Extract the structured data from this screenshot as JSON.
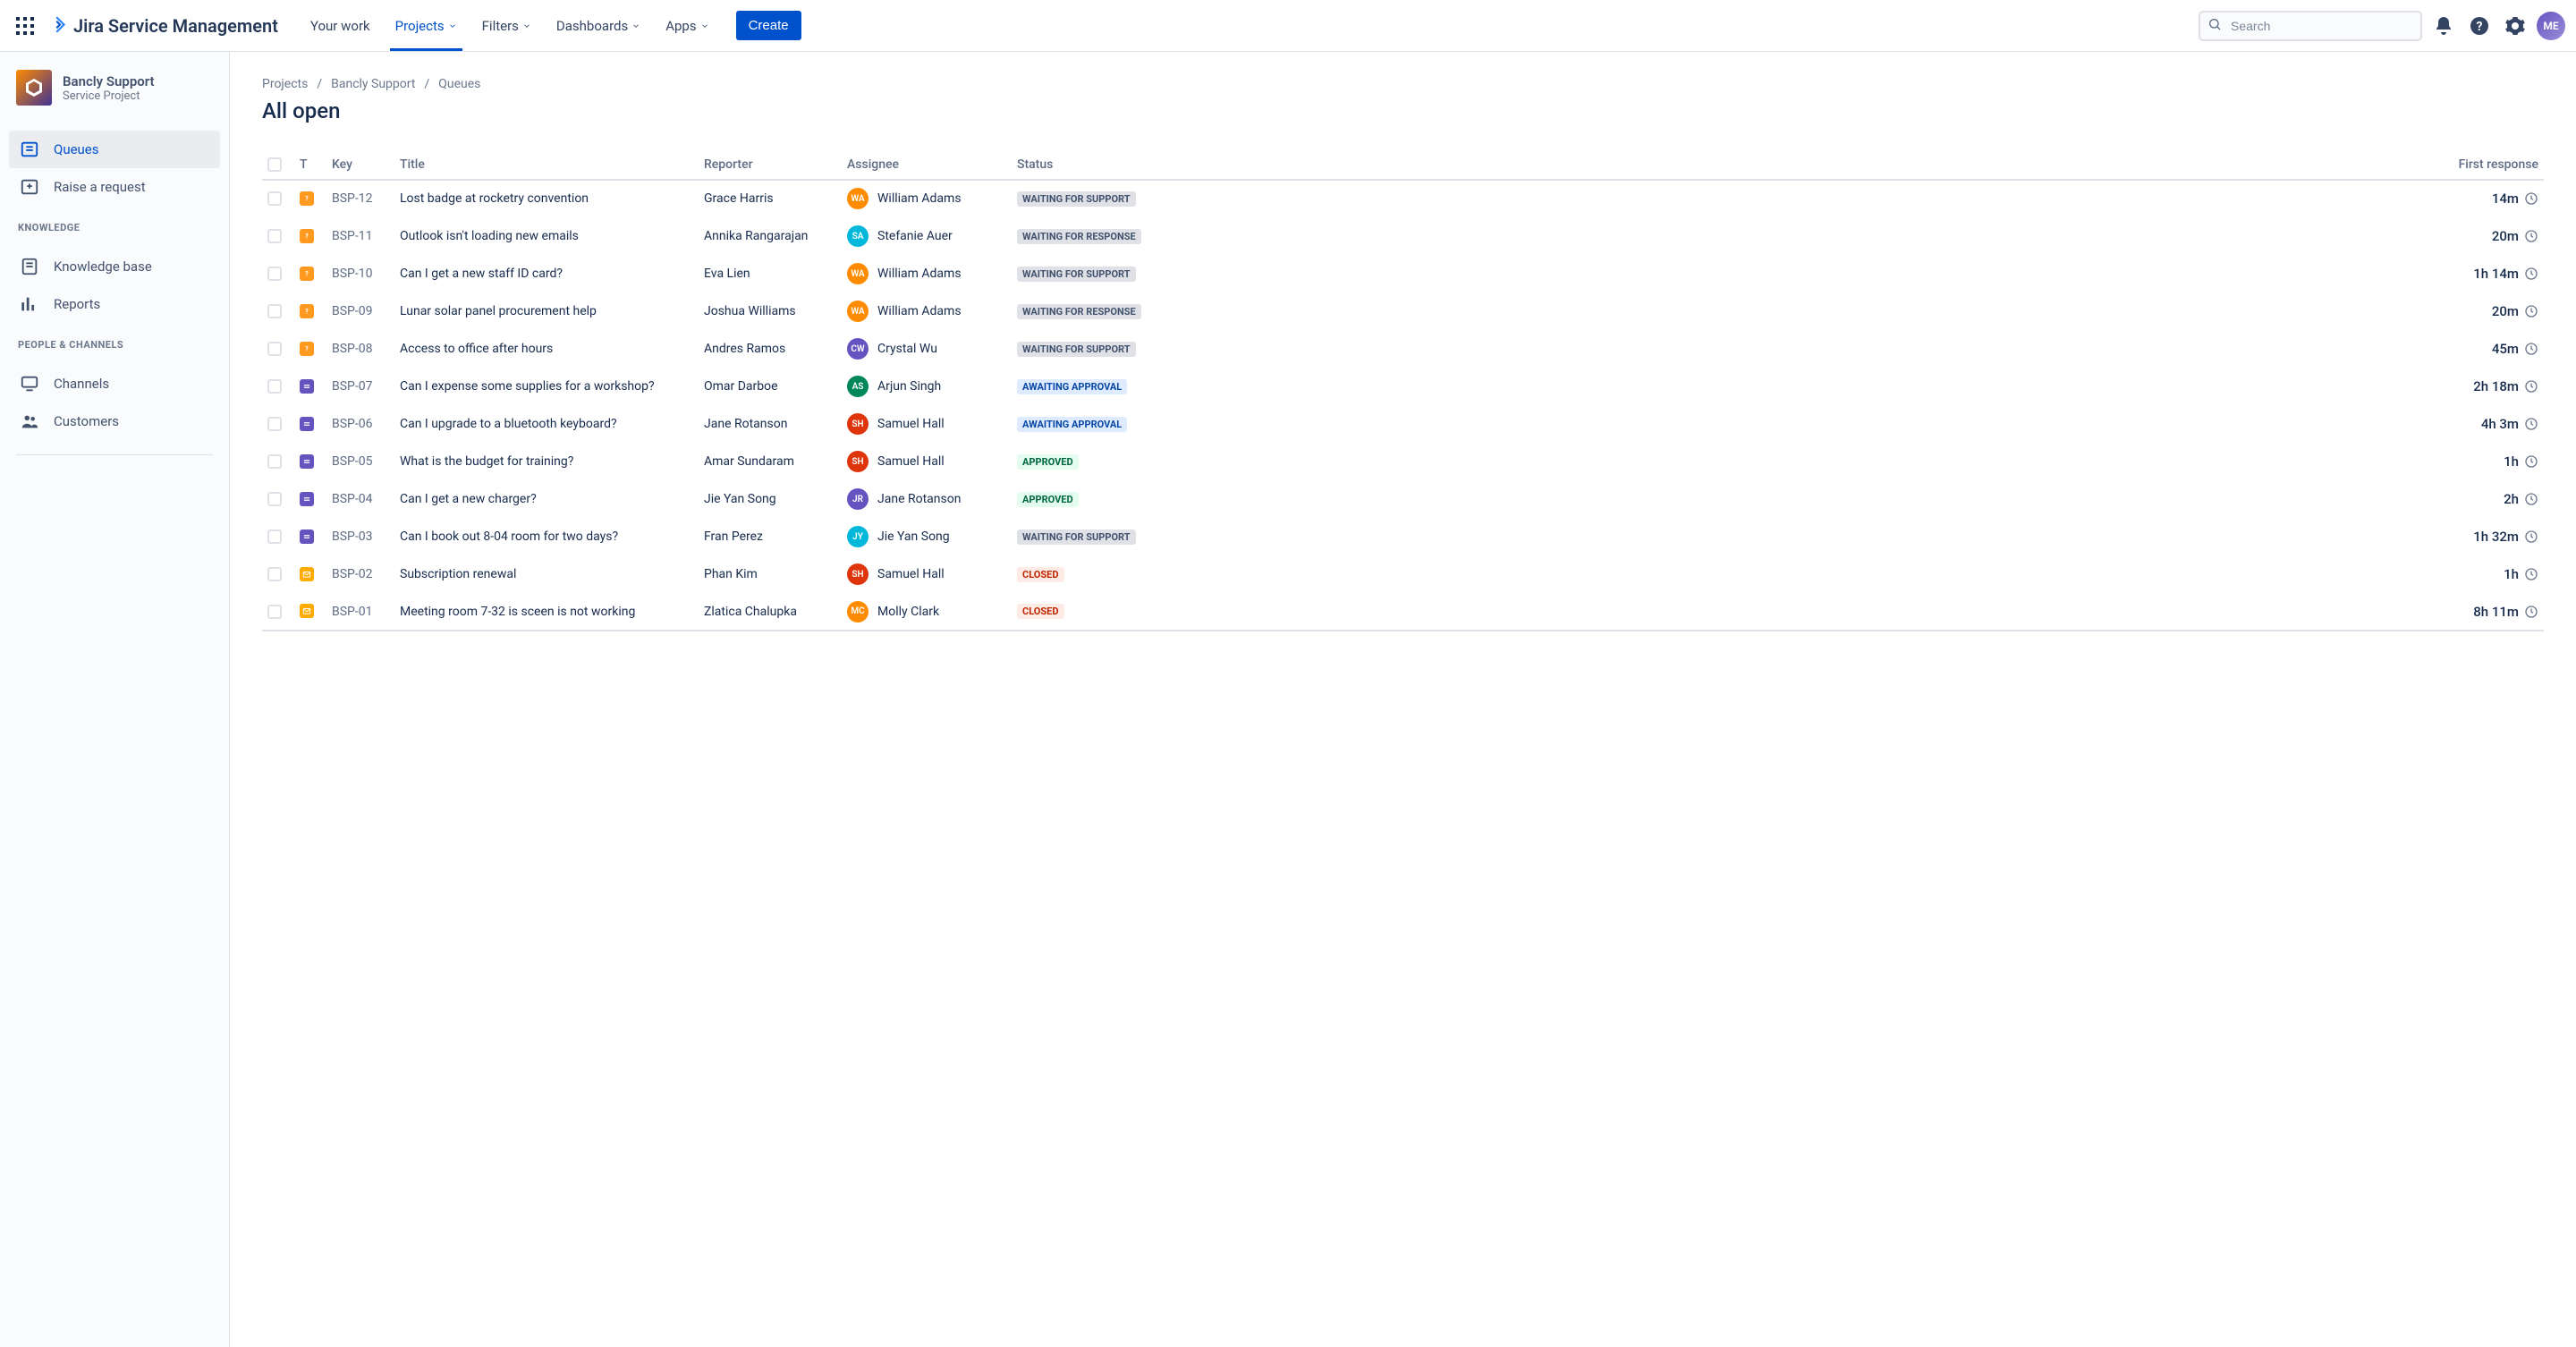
{
  "app": {
    "name": "Jira Service Management"
  },
  "topnav": {
    "items": [
      {
        "label": "Your work",
        "dropdown": false
      },
      {
        "label": "Projects",
        "dropdown": true,
        "active": true
      },
      {
        "label": "Filters",
        "dropdown": true
      },
      {
        "label": "Dashboards",
        "dropdown": true
      },
      {
        "label": "Apps",
        "dropdown": true
      }
    ],
    "create_label": "Create",
    "search_placeholder": "Search"
  },
  "sidebar": {
    "project_name": "Bancly Support",
    "project_type": "Service Project",
    "items_main": [
      {
        "label": "Queues",
        "icon": "queue",
        "active": true
      },
      {
        "label": "Raise a request",
        "icon": "request"
      }
    ],
    "section_knowledge": {
      "heading": "Knowledge",
      "items": [
        {
          "label": "Knowledge base",
          "icon": "book"
        },
        {
          "label": "Reports",
          "icon": "chart"
        }
      ]
    },
    "section_people": {
      "heading": "People & Channels",
      "items": [
        {
          "label": "Channels",
          "icon": "monitor"
        },
        {
          "label": "Customers",
          "icon": "people"
        }
      ]
    }
  },
  "breadcrumb": {
    "items": [
      "Projects",
      "Bancly Support",
      "Queues"
    ]
  },
  "page": {
    "title": "All open"
  },
  "table": {
    "headers": {
      "type": "T",
      "key": "Key",
      "title": "Title",
      "reporter": "Reporter",
      "assignee": "Assignee",
      "status": "Status",
      "first_response": "First response"
    },
    "rows": [
      {
        "type": "question",
        "key": "BSP-12",
        "title": "Lost badge at rocketry convention",
        "reporter": "Grace Harris",
        "assignee": "William Adams",
        "assignee_color": "#FF8B00",
        "status": "Waiting for support",
        "status_class": "waiting-support",
        "response": "14m"
      },
      {
        "type": "question",
        "key": "BSP-11",
        "title": "Outlook isn't loading new emails",
        "reporter": "Annika Rangarajan",
        "assignee": "Stefanie Auer",
        "assignee_color": "#00B8D9",
        "status": "Waiting for response",
        "status_class": "waiting-response",
        "response": "20m"
      },
      {
        "type": "question",
        "key": "BSP-10",
        "title": "Can I get a new staff ID card?",
        "reporter": "Eva Lien",
        "assignee": "William Adams",
        "assignee_color": "#FF8B00",
        "status": "Waiting for support",
        "status_class": "waiting-support",
        "response": "1h 14m"
      },
      {
        "type": "question",
        "key": "BSP-09",
        "title": "Lunar solar panel procurement help",
        "reporter": "Joshua Williams",
        "assignee": "William Adams",
        "assignee_color": "#FF8B00",
        "status": "Waiting for response",
        "status_class": "waiting-response",
        "response": "20m"
      },
      {
        "type": "question",
        "key": "BSP-08",
        "title": "Access to office after hours",
        "reporter": "Andres Ramos",
        "assignee": "Crystal Wu",
        "assignee_color": "#6554C0",
        "status": "Waiting for support",
        "status_class": "waiting-support",
        "response": "45m"
      },
      {
        "type": "service",
        "key": "BSP-07",
        "title": "Can I expense some supplies for a workshop?",
        "reporter": "Omar Darboe",
        "assignee": "Arjun Singh",
        "assignee_color": "#00875A",
        "status": "Awaiting approval",
        "status_class": "awaiting-approval",
        "response": "2h 18m"
      },
      {
        "type": "service",
        "key": "BSP-06",
        "title": "Can I upgrade to a bluetooth keyboard?",
        "reporter": "Jane Rotanson",
        "assignee": "Samuel Hall",
        "assignee_color": "#DE350B",
        "status": "Awaiting approval",
        "status_class": "awaiting-approval",
        "response": "4h 3m"
      },
      {
        "type": "service",
        "key": "BSP-05",
        "title": "What is the budget for training?",
        "reporter": "Amar Sundaram",
        "assignee": "Samuel Hall",
        "assignee_color": "#DE350B",
        "status": "Approved",
        "status_class": "approved",
        "response": "1h"
      },
      {
        "type": "service",
        "key": "BSP-04",
        "title": "Can I get a new charger?",
        "reporter": "Jie Yan Song",
        "assignee": "Jane Rotanson",
        "assignee_color": "#6554C0",
        "status": "Approved",
        "status_class": "approved",
        "response": "2h"
      },
      {
        "type": "service",
        "key": "BSP-03",
        "title": "Can I book out 8-04 room for two days?",
        "reporter": "Fran Perez",
        "assignee": "Jie Yan Song",
        "assignee_color": "#00B8D9",
        "status": "Waiting for support",
        "status_class": "waiting-support",
        "response": "1h 32m"
      },
      {
        "type": "email",
        "key": "BSP-02",
        "title": "Subscription renewal",
        "reporter": "Phan Kim",
        "assignee": "Samuel Hall",
        "assignee_color": "#DE350B",
        "status": "Closed",
        "status_class": "closed",
        "response": "1h"
      },
      {
        "type": "email",
        "key": "BSP-01",
        "title": "Meeting room 7-32 is sceen is not working",
        "reporter": "Zlatica Chalupka",
        "assignee": "Molly Clark",
        "assignee_color": "#FF8B00",
        "status": "Closed",
        "status_class": "closed",
        "response": "8h 11m"
      }
    ]
  }
}
